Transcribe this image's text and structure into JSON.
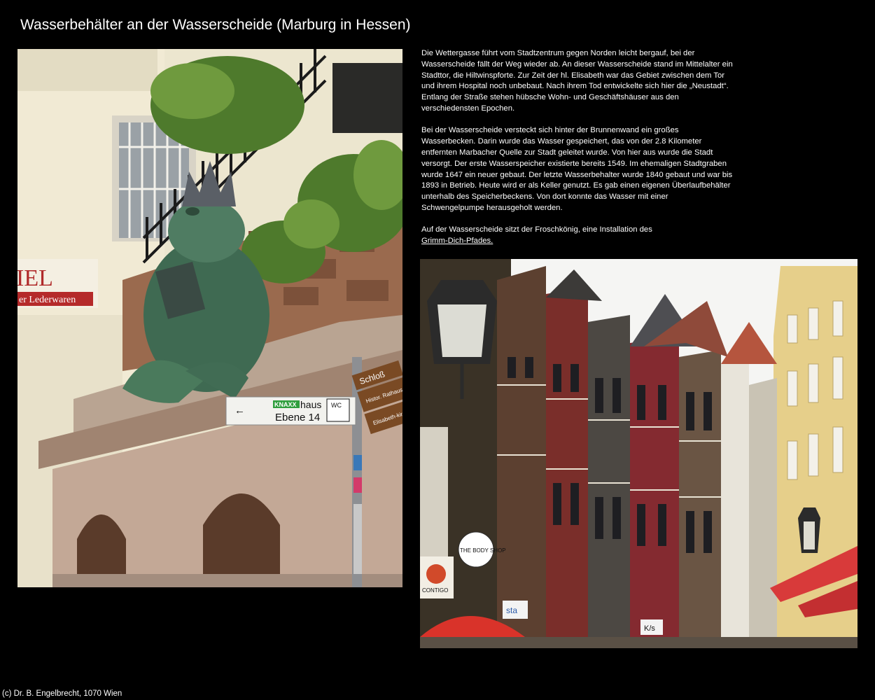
{
  "page": {
    "title": "Wasserbehälter an der Wasserscheide (Marburg in Hessen)",
    "footer": "(c) Dr. B. Engelbrecht, 1070 Wien"
  },
  "text": {
    "paragraph1": "Die Wettergasse führt vom Stadtzentrum gegen Norden leicht bergauf, bei der Wasserscheide fällt der Weg wieder ab. An dieser Wasserscheide stand im Mittelalter ein Stadttor, die Hiltwinspforte. Zur Zeit der hl. Elisabeth war das Gebiet zwischen dem Tor und ihrem Hospital noch unbebaut. Nach ihrem Tod entwickelte sich hier die „Neustadt“. Entlang der Straße stehen hübsche Wohn- und Geschäftshäuser aus den verschiedensten Epochen.",
    "paragraph2": "Bei der Wasserscheide versteckt sich hinter der Brunnenwand ein großes Wasserbecken. Darin wurde das Wasser gespeichert, das von der 2.8 Kilometer entfernten Marbacher Quelle zur Stadt geleitet wurde. Von hier aus wurde die Stadt versorgt. Der erste Wasserspeicher existierte bereits 1549. Im ehemaligen Stadtgraben wurde 1647 ein neuer gebaut. Der letzte Wasserbehalter wurde 1840 gebaut und war bis 1893 in Betrieb. Heute wird er als Keller genutzt. Es gab einen eigenen Überlaufbehälter unterhalb des Speicherbeckens. Von dort konnte das Wasser mit einer Schwengelpumpe herausgeholt werden.",
    "paragraph3_prefix": "Auf der Wasserscheide sitzt der Froschkönig, eine Installation des",
    "paragraph3_link": "Grimm-Dich-Pfades."
  },
  "photo_frog": {
    "shop_sign_top": "IEL",
    "shop_sign_bottom": "er Lederwaren",
    "sign_haus_brand": "KNAXX",
    "sign_haus": "haus",
    "sign_wc": "WC",
    "sign_ebene": "Ebene 14",
    "sign_schloss": "Schloß",
    "sign_rathaus": "Histor. Rathaus",
    "sign_kirche": "Elisabeth-kirche"
  },
  "photo_street": {
    "shop_body": "THE BODY SHOP",
    "shop_contigo": "CONTIGO",
    "shop_sign_small": "sta",
    "shop_kl": "K/s"
  }
}
